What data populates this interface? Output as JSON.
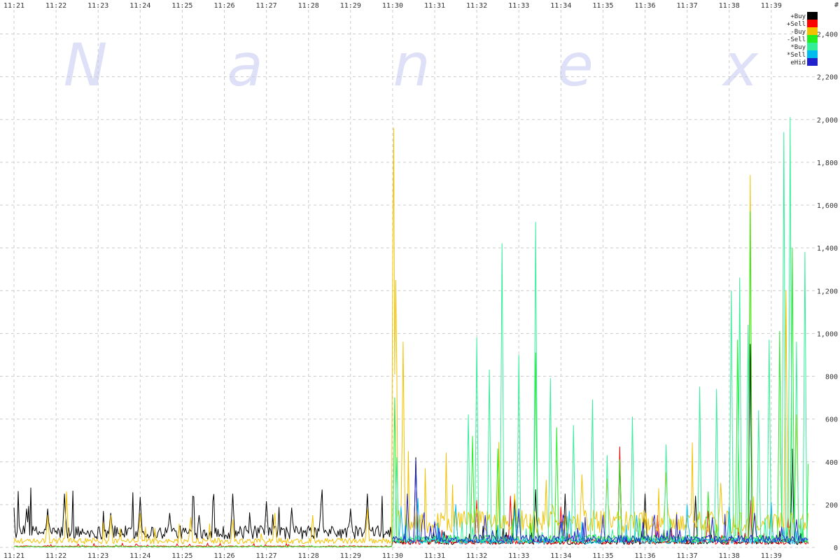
{
  "watermark": [
    "N",
    "a",
    "n",
    "e",
    "x"
  ],
  "chart_data": {
    "type": "line",
    "x_ticks": [
      "11:21",
      "11:22",
      "11:23",
      "11:24",
      "11:25",
      "11:26",
      "11:27",
      "11:28",
      "11:29",
      "11:30",
      "11:31",
      "11:32",
      "11:33",
      "11:34",
      "11:35",
      "11:36",
      "11:37",
      "11:38",
      "11:39"
    ],
    "x_range_minutes": [
      0,
      19.1
    ],
    "y_ticks": [
      "0",
      "200",
      "400",
      "600",
      "800",
      "1,000",
      "1,200",
      "1,400",
      "1,600",
      "1,800",
      "2,000",
      "2,200",
      "2,400"
    ],
    "y_tick_values": [
      0,
      200,
      400,
      600,
      800,
      1000,
      1200,
      1400,
      1600,
      1800,
      2000,
      2200,
      2400
    ],
    "y_unit_label": "#",
    "ylim": [
      0,
      2500
    ],
    "grid": true,
    "legend_position": "top-right",
    "series": [
      {
        "name": "+Buy",
        "color": "#000000",
        "baseline_before": 70,
        "baseline_after": 25,
        "peaks": [
          [
            0.3,
            180
          ],
          [
            0.8,
            180
          ],
          [
            1.2,
            250
          ],
          [
            2.3,
            160
          ],
          [
            3.0,
            235
          ],
          [
            3.7,
            160
          ],
          [
            4.4,
            150
          ],
          [
            5.2,
            250
          ],
          [
            6.0,
            215
          ],
          [
            6.6,
            185
          ],
          [
            7.3,
            210
          ],
          [
            8.0,
            180
          ],
          [
            8.4,
            250
          ],
          [
            9.55,
            420
          ],
          [
            11.9,
            240
          ],
          [
            12.4,
            270
          ],
          [
            13.1,
            250
          ],
          [
            14.4,
            430
          ],
          [
            15.0,
            250
          ],
          [
            16.2,
            240
          ],
          [
            17.5,
            950
          ],
          [
            18.5,
            460
          ]
        ]
      },
      {
        "name": "+Sell",
        "color": "#ff0000",
        "baseline_before": 5,
        "baseline_after": 25,
        "peaks": [
          [
            11.0,
            220
          ],
          [
            11.8,
            240
          ],
          [
            13.0,
            190
          ],
          [
            14.4,
            470
          ],
          [
            15.3,
            150
          ],
          [
            16.5,
            170
          ],
          [
            17.5,
            220
          ],
          [
            18.4,
            150
          ]
        ]
      },
      {
        "name": "-Buy",
        "color": "#f2c200",
        "baseline_before": 30,
        "baseline_after": 120,
        "peaks": [
          [
            0.8,
            150
          ],
          [
            1.25,
            260
          ],
          [
            2.3,
            150
          ],
          [
            3.0,
            160
          ],
          [
            4.2,
            140
          ],
          [
            5.2,
            130
          ],
          [
            6.2,
            160
          ],
          [
            7.1,
            150
          ],
          [
            8.4,
            180
          ],
          [
            9.02,
            2190
          ],
          [
            9.08,
            1390
          ],
          [
            9.25,
            960
          ],
          [
            11.0,
            180
          ],
          [
            11.9,
            250
          ],
          [
            12.8,
            200
          ],
          [
            13.5,
            340
          ],
          [
            14.1,
            320
          ],
          [
            15.5,
            350
          ],
          [
            16.8,
            300
          ],
          [
            17.5,
            1740
          ],
          [
            18.35,
            1200
          ],
          [
            18.6,
            620
          ],
          [
            18.9,
            210
          ]
        ]
      },
      {
        "name": "-Sell",
        "color": "#22ee22",
        "baseline_before": 3,
        "baseline_after": 40,
        "peaks": [
          [
            9.05,
            700
          ],
          [
            10.9,
            520
          ],
          [
            11.5,
            460
          ],
          [
            12.4,
            910
          ],
          [
            12.9,
            560
          ],
          [
            14.4,
            410
          ],
          [
            16.5,
            260
          ],
          [
            17.2,
            970
          ],
          [
            17.5,
            1570
          ],
          [
            18.2,
            1010
          ],
          [
            18.5,
            1400
          ],
          [
            18.9,
            830
          ]
        ]
      },
      {
        "name": "*Buy",
        "color": "#33ee99",
        "baseline_before": 0,
        "baseline_after": 35,
        "peaks": [
          [
            9.1,
            420
          ],
          [
            10.8,
            620
          ],
          [
            11.0,
            980
          ],
          [
            11.3,
            830
          ],
          [
            11.6,
            1420
          ],
          [
            12.0,
            900
          ],
          [
            12.4,
            1520
          ],
          [
            12.75,
            790
          ],
          [
            13.3,
            570
          ],
          [
            13.75,
            690
          ],
          [
            14.1,
            430
          ],
          [
            14.7,
            610
          ],
          [
            15.5,
            480
          ],
          [
            16.3,
            750
          ],
          [
            16.7,
            740
          ],
          [
            17.05,
            1200
          ],
          [
            17.25,
            1260
          ],
          [
            17.45,
            1040
          ],
          [
            17.7,
            640
          ],
          [
            17.95,
            970
          ],
          [
            18.3,
            1940
          ],
          [
            18.45,
            2010
          ],
          [
            18.6,
            960
          ],
          [
            18.8,
            1380
          ],
          [
            18.95,
            400
          ]
        ]
      },
      {
        "name": "*Sell",
        "color": "#00bbee",
        "baseline_before": 0,
        "baseline_after": 30,
        "peaks": [
          [
            9.2,
            190
          ],
          [
            9.6,
            230
          ],
          [
            10.5,
            200
          ],
          [
            11.9,
            180
          ],
          [
            13.2,
            170
          ],
          [
            14.8,
            150
          ],
          [
            16.0,
            200
          ],
          [
            17.0,
            190
          ],
          [
            18.0,
            210
          ]
        ]
      },
      {
        "name": "eHid",
        "color": "#2222cc",
        "baseline_before": 0,
        "baseline_after": 40,
        "peaks": [
          [
            9.35,
            250
          ],
          [
            9.55,
            410
          ],
          [
            10.0,
            120
          ],
          [
            11.2,
            150
          ],
          [
            12.0,
            180
          ],
          [
            13.0,
            120
          ],
          [
            14.0,
            150
          ],
          [
            15.2,
            130
          ],
          [
            16.6,
            140
          ],
          [
            17.6,
            160
          ],
          [
            18.6,
            130
          ]
        ]
      }
    ]
  }
}
